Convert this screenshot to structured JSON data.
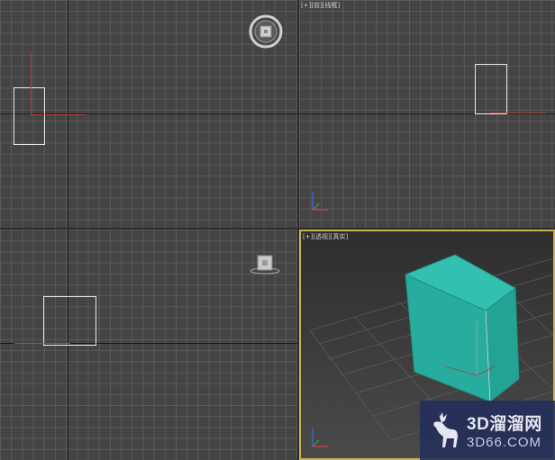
{
  "viewports": {
    "top": {
      "label": ""
    },
    "front": {
      "label": {
        "plus": "[+]",
        "view": "[前]",
        "mode": "[线框]"
      }
    },
    "left": {
      "label": ""
    },
    "perspective": {
      "label": {
        "plus": "[+]",
        "view": "[透视]",
        "mode": "[真实]"
      }
    }
  },
  "objects": {
    "box_color": "#2bb5a5",
    "wire_color": "#e8e8e8",
    "pivot_color": "#b84040"
  },
  "watermark": {
    "title": "3D溜溜网",
    "subtitle": "3D66.COM"
  }
}
